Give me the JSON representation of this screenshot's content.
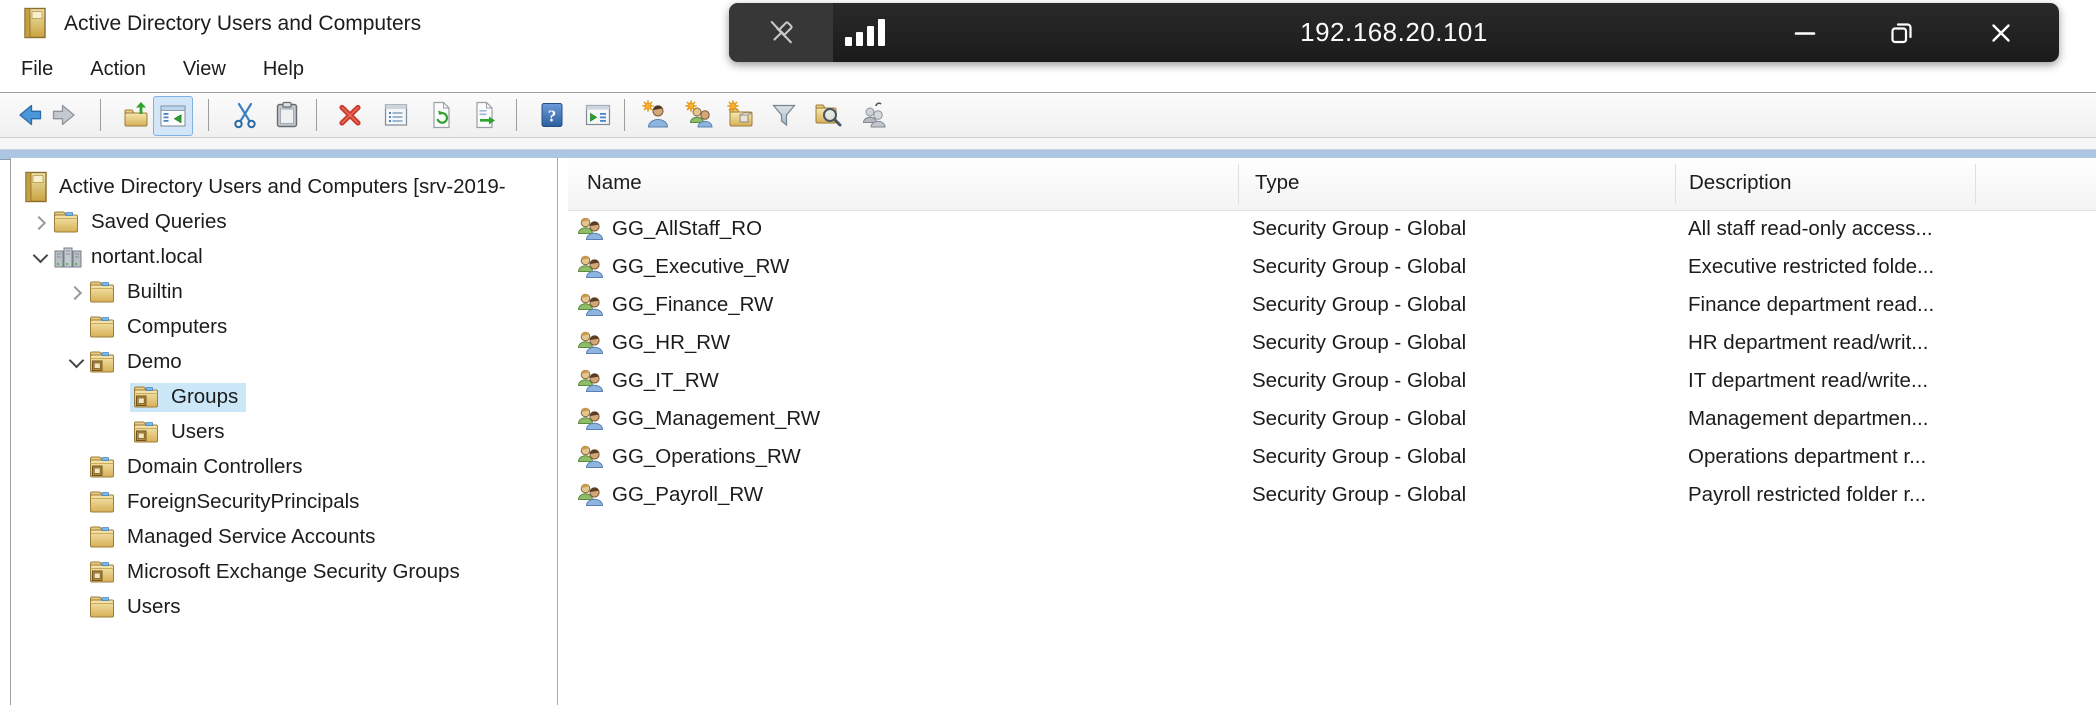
{
  "window": {
    "title": "Active Directory Users and Computers"
  },
  "overlay": {
    "address": "192.168.20.101",
    "icons": [
      "unpin-icon",
      "signal-bars-icon",
      "minimize-icon",
      "restore-icon",
      "close-icon"
    ],
    "bg": "#1f1f1f"
  },
  "menu": {
    "items": [
      "File",
      "Action",
      "View",
      "Help"
    ]
  },
  "toolbar": {
    "icons": [
      "back-icon",
      "forward-icon",
      "up-one-level-icon",
      "show-console-tree-icon",
      "cut-icon",
      "paste-icon",
      "delete-icon",
      "properties-icon",
      "refresh-icon",
      "export-list-icon",
      "help-icon",
      "new-window-icon",
      "new-user-icon",
      "new-group-icon",
      "new-organizational-unit-icon",
      "filter-icon",
      "find-icon",
      "accounts-icon"
    ],
    "toggled_icon": "show-console-tree-icon"
  },
  "tree": {
    "items": [
      {
        "label": "Active Directory Users and Computers [srv-2019-",
        "level": 0,
        "icon": "book",
        "expander": "none",
        "selected": false
      },
      {
        "label": "Saved Queries",
        "level": 1,
        "icon": "folder",
        "expander": "collapsed",
        "selected": false
      },
      {
        "label": "nortant.local",
        "level": 1,
        "icon": "domain",
        "expander": "expanded",
        "selected": false
      },
      {
        "label": "Builtin",
        "level": 2,
        "icon": "folder",
        "expander": "collapsed",
        "selected": false
      },
      {
        "label": "Computers",
        "level": 2,
        "icon": "folder",
        "expander": "none",
        "selected": false
      },
      {
        "label": "Demo",
        "level": 2,
        "icon": "ou-folder",
        "expander": "expanded",
        "selected": false
      },
      {
        "label": "Groups",
        "level": 3,
        "icon": "ou-folder",
        "expander": "none",
        "selected": true
      },
      {
        "label": "Users",
        "level": 3,
        "icon": "ou-folder",
        "expander": "none",
        "selected": false
      },
      {
        "label": "Domain Controllers",
        "level": 2,
        "icon": "ou-folder",
        "expander": "none",
        "selected": false
      },
      {
        "label": "ForeignSecurityPrincipals",
        "level": 2,
        "icon": "folder",
        "expander": "none",
        "selected": false
      },
      {
        "label": "Managed Service Accounts",
        "level": 2,
        "icon": "folder",
        "expander": "none",
        "selected": false
      },
      {
        "label": "Microsoft Exchange Security Groups",
        "level": 2,
        "icon": "ou-folder",
        "expander": "none",
        "selected": false
      },
      {
        "label": "Users",
        "level": 2,
        "icon": "folder",
        "expander": "none",
        "selected": false
      }
    ]
  },
  "list": {
    "columns": [
      {
        "label": "Name"
      },
      {
        "label": "Type"
      },
      {
        "label": "Description"
      }
    ],
    "rows": [
      {
        "name": "GG_AllStaff_RO",
        "type": "Security Group - Global",
        "description": "All staff read-only access..."
      },
      {
        "name": "GG_Executive_RW",
        "type": "Security Group - Global",
        "description": "Executive restricted folde..."
      },
      {
        "name": "GG_Finance_RW",
        "type": "Security Group - Global",
        "description": "Finance department read..."
      },
      {
        "name": "GG_HR_RW",
        "type": "Security Group - Global",
        "description": "HR department read/writ..."
      },
      {
        "name": "GG_IT_RW",
        "type": "Security Group - Global",
        "description": "IT department read/write..."
      },
      {
        "name": "GG_Management_RW",
        "type": "Security Group - Global",
        "description": "Management departmen..."
      },
      {
        "name": "GG_Operations_RW",
        "type": "Security Group - Global",
        "description": "Operations department r..."
      },
      {
        "name": "GG_Payroll_RW",
        "type": "Security Group - Global",
        "description": "Payroll restricted folder r..."
      }
    ]
  },
  "colors": {
    "selection": "#cbe7f8",
    "blue_strip": "#adc6e2",
    "overlay_bar": "#1f1f1f",
    "folder_gold": "#d7b057",
    "toolbar_toggle_bg": "#d2e6f8"
  }
}
